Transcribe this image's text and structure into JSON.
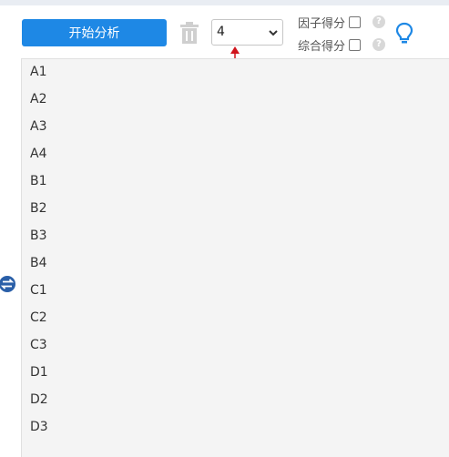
{
  "toolbar": {
    "start_label": "开始分析",
    "select_value": "4",
    "factor_score_label": "因子得分",
    "composite_score_label": "综合得分",
    "help_glyph": "?"
  },
  "variables": [
    "A1",
    "A2",
    "A3",
    "A4",
    "B1",
    "B2",
    "B3",
    "B4",
    "C1",
    "C2",
    "C3",
    "D1",
    "D2",
    "D3"
  ],
  "colors": {
    "primary": "#1e88e5",
    "arrow": "#d0141c",
    "swap_icon": "#2a5fa8",
    "panel": "#f4f4f4"
  },
  "icons": [
    "trash-icon",
    "chevron-down-icon",
    "help-icon",
    "lightbulb-icon",
    "swap-icon",
    "arrow-indicator"
  ]
}
